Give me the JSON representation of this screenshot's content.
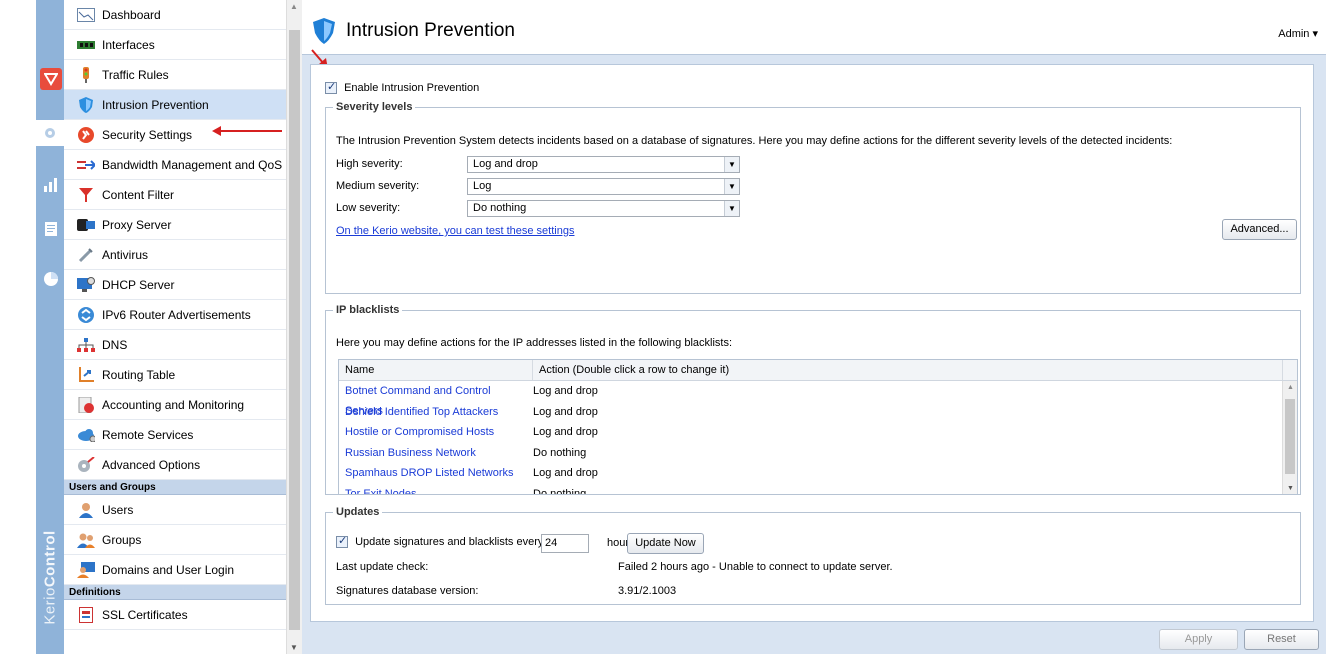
{
  "header": {
    "title": "Intrusion Prevention",
    "user_menu": "Admin ▾"
  },
  "nav": {
    "items": [
      {
        "label": "Dashboard",
        "icon": "dashboard-icon"
      },
      {
        "label": "Interfaces",
        "icon": "interfaces-icon"
      },
      {
        "label": "Traffic Rules",
        "icon": "traffic-rules-icon"
      },
      {
        "label": "Intrusion Prevention",
        "icon": "shield-icon",
        "active": true
      },
      {
        "label": "Security Settings",
        "icon": "security-icon"
      },
      {
        "label": "Bandwidth Management and QoS",
        "icon": "bandwidth-icon"
      },
      {
        "label": "Content Filter",
        "icon": "filter-icon"
      },
      {
        "label": "Proxy Server",
        "icon": "proxy-icon"
      },
      {
        "label": "Antivirus",
        "icon": "antivirus-icon"
      },
      {
        "label": "DHCP Server",
        "icon": "dhcp-icon"
      },
      {
        "label": "IPv6 Router Advertisements",
        "icon": "ipv6-icon"
      },
      {
        "label": "DNS",
        "icon": "dns-icon"
      },
      {
        "label": "Routing Table",
        "icon": "routing-icon"
      },
      {
        "label": "Accounting and Monitoring",
        "icon": "accounting-icon"
      },
      {
        "label": "Remote Services",
        "icon": "cloud-icon"
      },
      {
        "label": "Advanced Options",
        "icon": "advanced-icon"
      }
    ],
    "section_users": "Users and Groups",
    "users_items": [
      {
        "label": "Users",
        "icon": "user-icon"
      },
      {
        "label": "Groups",
        "icon": "groups-icon"
      },
      {
        "label": "Domains and User Login",
        "icon": "domains-icon"
      }
    ],
    "section_definitions": "Definitions",
    "definitions_items": [
      {
        "label": "SSL Certificates",
        "icon": "certificate-icon"
      }
    ]
  },
  "rail": {
    "brand_light": "Kerio",
    "brand_bold": "Control"
  },
  "enable": {
    "label": "Enable Intrusion Prevention",
    "checked": true
  },
  "severity": {
    "legend": "Severity levels",
    "description": "The Intrusion Prevention System detects incidents based on a database of signatures. Here you may define actions for the different severity levels of the detected incidents:",
    "high_label": "High severity:",
    "high_value": "Log and drop",
    "medium_label": "Medium severity:",
    "medium_value": "Log",
    "low_label": "Low severity:",
    "low_value": "Do nothing",
    "test_link": "On the Kerio website, you can test these settings",
    "advanced_button": "Advanced..."
  },
  "blacklists": {
    "legend": "IP blacklists",
    "description": "Here you may define actions for the IP addresses listed in the following blacklists:",
    "columns": [
      "Name",
      "Action (Double click a row to change it)"
    ],
    "rows": [
      {
        "name": "Botnet Command and Control Servers",
        "action": "Log and drop"
      },
      {
        "name": "Dshield Identified Top Attackers",
        "action": "Log and drop"
      },
      {
        "name": "Hostile or Compromised Hosts",
        "action": "Log and drop"
      },
      {
        "name": "Russian Business Network",
        "action": "Do nothing"
      },
      {
        "name": "Spamhaus DROP Listed Networks",
        "action": "Log and drop"
      },
      {
        "name": "Tor Exit Nodes",
        "action": "Do nothing"
      }
    ]
  },
  "updates": {
    "legend": "Updates",
    "update_label": "Update signatures and blacklists every",
    "interval": "24",
    "unit": "hours",
    "update_button": "Update Now",
    "last_check_label": "Last update check:",
    "last_check_value": "Failed 2 hours ago - Unable to connect to update server.",
    "db_version_label": "Signatures database version:",
    "db_version_value": "3.91/2.1003"
  },
  "footer": {
    "apply": "Apply",
    "reset": "Reset"
  },
  "colors": {
    "accent": "#8fb3d9",
    "active_row": "#cfe0f5",
    "link": "#1a3bd6",
    "annotation_arrow": "#d62020"
  }
}
